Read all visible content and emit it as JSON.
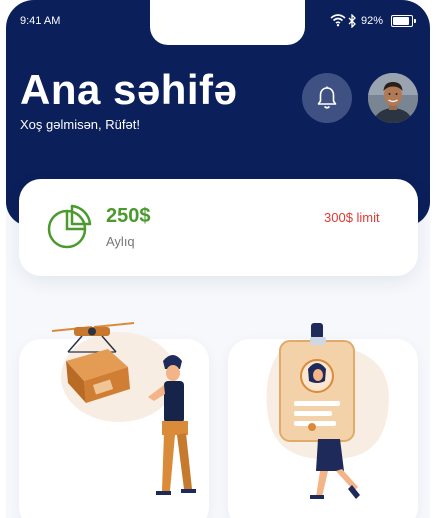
{
  "status_bar": {
    "time": "9:41 AM",
    "battery_percent": "92%",
    "icons": [
      "wifi-icon",
      "bluetooth-icon",
      "battery-icon"
    ]
  },
  "header": {
    "title": "Ana səhifə",
    "greeting": "Xoş gəlmisən, Rüfət!",
    "notification_icon": "bell-icon",
    "colors": {
      "background": "#0b1f5b",
      "bell_button": "#3f5183"
    }
  },
  "budget": {
    "amount": "250$",
    "period": "Aylıq",
    "limit": "300$ limit",
    "icon": "pie-chart-icon",
    "colors": {
      "amount": "#4b9a2e",
      "limit": "#e53935"
    }
  },
  "tiles": [
    {
      "illustration": "drone-delivery-illustration"
    },
    {
      "illustration": "id-badge-illustration"
    }
  ]
}
